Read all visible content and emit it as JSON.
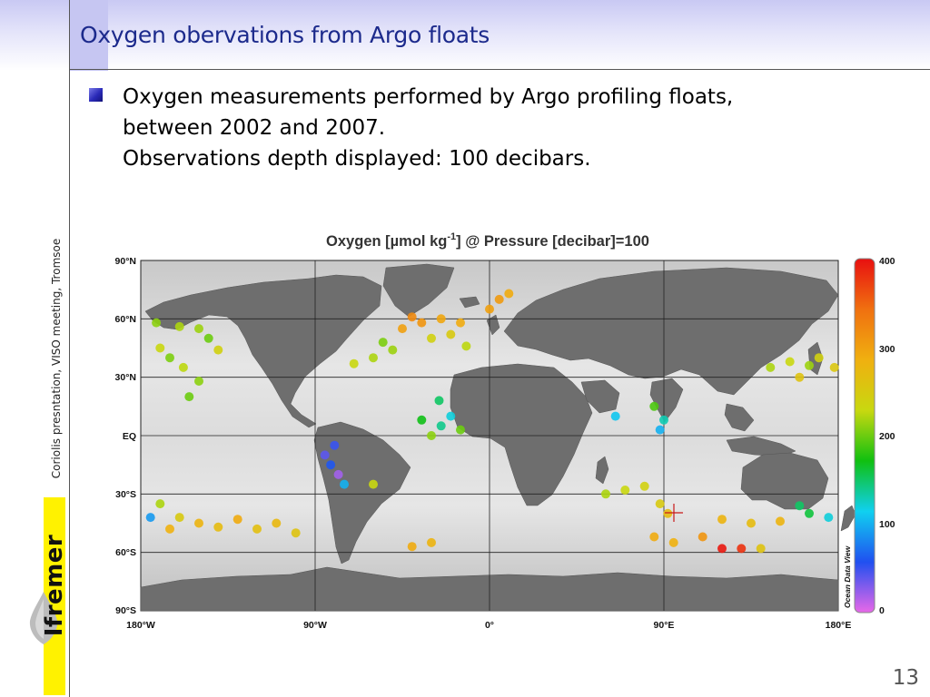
{
  "slide": {
    "title": "Oxygen obervations from Argo floats",
    "bullet_lines": [
      "Oxygen measurements performed by Argo profiling floats,",
      "between 2002 and 2007.",
      "Observations depth displayed: 100 decibars."
    ],
    "side_text": "Coriolis presntation, VISO meeting, Tromsoe",
    "logo_text": "Ifremer",
    "page_number": "13"
  },
  "map": {
    "title_prefix": "Oxygen [µmol kg",
    "title_sup": "-1",
    "title_suffix": "] @ Pressure [decibar]=100",
    "lat_labels": [
      "90°N",
      "60°N",
      "30°N",
      "EQ",
      "30°S",
      "60°S",
      "90°S"
    ],
    "lon_labels": [
      "180°W",
      "90°W",
      "0°",
      "90°E",
      "180°E"
    ],
    "colorbar_labels": [
      "400",
      "300",
      "200",
      "100",
      "0"
    ],
    "colorbar_value_range": [
      0,
      400
    ],
    "colorbar_stops": [
      "#e868e8",
      "#2050f0",
      "#10d0f0",
      "#10c010",
      "#c8d810",
      "#f0b010",
      "#f07010",
      "#e81010"
    ],
    "credit": "Ocean Data View",
    "colors": {
      "land": "#6e6e6e",
      "ocean_light": "#e4e4e4",
      "ocean_mid": "#b0b0b0",
      "title": "#1c2a8c"
    },
    "observations": [
      {
        "lon": -172,
        "lat": 58,
        "value": 210
      },
      {
        "lon": -160,
        "lat": 56,
        "value": 220
      },
      {
        "lon": -150,
        "lat": 55,
        "value": 215
      },
      {
        "lon": -145,
        "lat": 50,
        "value": 200
      },
      {
        "lon": -170,
        "lat": 45,
        "value": 230
      },
      {
        "lon": -165,
        "lat": 40,
        "value": 205
      },
      {
        "lon": -158,
        "lat": 35,
        "value": 225
      },
      {
        "lon": -150,
        "lat": 28,
        "value": 210
      },
      {
        "lon": -155,
        "lat": 20,
        "value": 200
      },
      {
        "lon": -140,
        "lat": 44,
        "value": 240
      },
      {
        "lon": -70,
        "lat": 37,
        "value": 230
      },
      {
        "lon": -60,
        "lat": 40,
        "value": 220
      },
      {
        "lon": -50,
        "lat": 44,
        "value": 215
      },
      {
        "lon": -55,
        "lat": 48,
        "value": 205
      },
      {
        "lon": -45,
        "lat": 55,
        "value": 300
      },
      {
        "lon": -35,
        "lat": 58,
        "value": 310
      },
      {
        "lon": -25,
        "lat": 60,
        "value": 295
      },
      {
        "lon": -20,
        "lat": 52,
        "value": 250
      },
      {
        "lon": -30,
        "lat": 50,
        "value": 240
      },
      {
        "lon": -40,
        "lat": 61,
        "value": 320
      },
      {
        "lon": -15,
        "lat": 58,
        "value": 290
      },
      {
        "lon": 0,
        "lat": 65,
        "value": 300
      },
      {
        "lon": 5,
        "lat": 70,
        "value": 305
      },
      {
        "lon": 10,
        "lat": 73,
        "value": 290
      },
      {
        "lon": -12,
        "lat": 46,
        "value": 225
      },
      {
        "lon": -26,
        "lat": 18,
        "value": 150
      },
      {
        "lon": -20,
        "lat": 10,
        "value": 120
      },
      {
        "lon": -25,
        "lat": 5,
        "value": 140
      },
      {
        "lon": -30,
        "lat": 0,
        "value": 210
      },
      {
        "lon": -35,
        "lat": 8,
        "value": 170
      },
      {
        "lon": -15,
        "lat": 3,
        "value": 200
      },
      {
        "lon": -85,
        "lat": -10,
        "value": 40
      },
      {
        "lon": -82,
        "lat": -15,
        "value": 60
      },
      {
        "lon": -78,
        "lat": -20,
        "value": 20
      },
      {
        "lon": -75,
        "lat": -25,
        "value": 100
      },
      {
        "lon": -80,
        "lat": -5,
        "value": 50
      },
      {
        "lon": -170,
        "lat": -35,
        "value": 220
      },
      {
        "lon": -160,
        "lat": -42,
        "value": 250
      },
      {
        "lon": -150,
        "lat": -45,
        "value": 280
      },
      {
        "lon": -140,
        "lat": -47,
        "value": 270
      },
      {
        "lon": -130,
        "lat": -43,
        "value": 290
      },
      {
        "lon": -120,
        "lat": -48,
        "value": 265
      },
      {
        "lon": -110,
        "lat": -45,
        "value": 275
      },
      {
        "lon": -100,
        "lat": -50,
        "value": 260
      },
      {
        "lon": -175,
        "lat": -42,
        "value": 90
      },
      {
        "lon": -165,
        "lat": -48,
        "value": 285
      },
      {
        "lon": -60,
        "lat": -25,
        "value": 230
      },
      {
        "lon": -40,
        "lat": -57,
        "value": 290
      },
      {
        "lon": -30,
        "lat": -55,
        "value": 280
      },
      {
        "lon": 60,
        "lat": -30,
        "value": 220
      },
      {
        "lon": 70,
        "lat": -28,
        "value": 230
      },
      {
        "lon": 80,
        "lat": -26,
        "value": 240
      },
      {
        "lon": 88,
        "lat": -35,
        "value": 250
      },
      {
        "lon": 92,
        "lat": -40,
        "value": 270
      },
      {
        "lon": 85,
        "lat": -52,
        "value": 290
      },
      {
        "lon": 95,
        "lat": -55,
        "value": 285
      },
      {
        "lon": 110,
        "lat": -52,
        "value": 310
      },
      {
        "lon": 120,
        "lat": -58,
        "value": 395
      },
      {
        "lon": 130,
        "lat": -58,
        "value": 380
      },
      {
        "lon": 140,
        "lat": -58,
        "value": 260
      },
      {
        "lon": 120,
        "lat": -43,
        "value": 280
      },
      {
        "lon": 135,
        "lat": -45,
        "value": 270
      },
      {
        "lon": 150,
        "lat": -44,
        "value": 280
      },
      {
        "lon": 160,
        "lat": -36,
        "value": 150
      },
      {
        "lon": 165,
        "lat": -40,
        "value": 160
      },
      {
        "lon": 175,
        "lat": -42,
        "value": 120
      },
      {
        "lon": 85,
        "lat": 15,
        "value": 190
      },
      {
        "lon": 90,
        "lat": 8,
        "value": 130
      },
      {
        "lon": 88,
        "lat": 3,
        "value": 100
      },
      {
        "lon": 65,
        "lat": 10,
        "value": 110
      },
      {
        "lon": 145,
        "lat": 35,
        "value": 220
      },
      {
        "lon": 155,
        "lat": 38,
        "value": 230
      },
      {
        "lon": 165,
        "lat": 36,
        "value": 215
      },
      {
        "lon": 170,
        "lat": 40,
        "value": 240
      },
      {
        "lon": 160,
        "lat": 30,
        "value": 260
      },
      {
        "lon": 178,
        "lat": 35,
        "value": 255
      }
    ]
  }
}
